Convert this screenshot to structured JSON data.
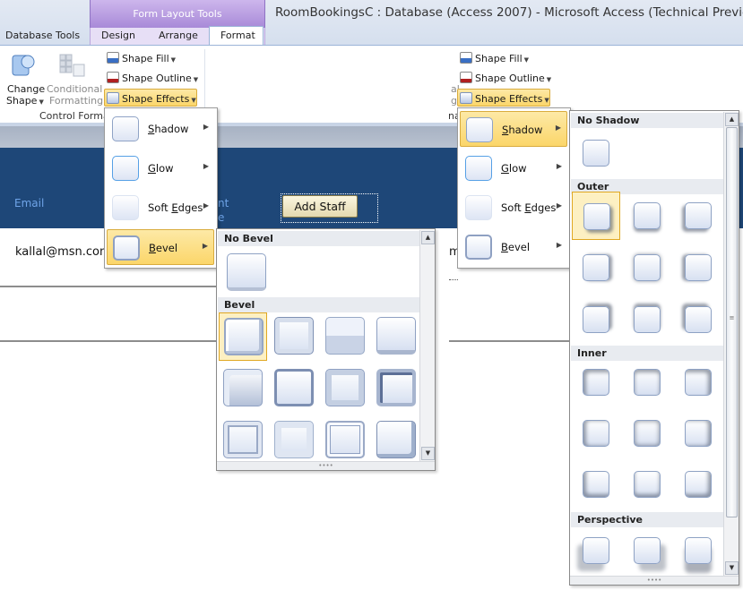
{
  "window": {
    "title": "RoomBookingsC : Database (Access 2007)  -  Microsoft Access (Technical Preview)",
    "contextual_group": "Form Layout Tools"
  },
  "tabs": [
    "Database Tools",
    "Design",
    "Arrange",
    "Format"
  ],
  "active_tab": "Format",
  "ribbon": {
    "change_shape_line1": "Change",
    "change_shape_line2": "Shape",
    "conditional_line1": "Conditional",
    "conditional_line2": "Formatting",
    "group_label": "Control Forma",
    "shape_fill": "Shape Fill",
    "shape_outline": "Shape Outline",
    "shape_effects": "Shape Effects",
    "right_group_fragment_a": "al",
    "right_group_fragment_b": "g",
    "right_group_fragment_c": "na"
  },
  "form": {
    "email_label": "Email",
    "partial_label_a": "nt",
    "partial_label_b": "e",
    "add_staff_button": "Add Staff",
    "email_value": "kallal@msn.com",
    "partial_value": "m"
  },
  "effects_menu": [
    {
      "label": "Shadow",
      "accel": "S",
      "rest": "hadow"
    },
    {
      "label": "Glow",
      "accel": "G",
      "rest": "low"
    },
    {
      "label": "Soft Edges",
      "pre": "Soft ",
      "accel": "E",
      "rest": "dges"
    },
    {
      "label": "Bevel",
      "accel": "B",
      "rest": "evel"
    }
  ],
  "bevel_gallery": {
    "no_bevel_heading": "No Bevel",
    "bevel_heading": "Bevel"
  },
  "shadow_gallery": {
    "no_shadow_heading": "No Shadow",
    "outer_heading": "Outer",
    "inner_heading": "Inner",
    "perspective_heading": "Perspective"
  },
  "colors": {
    "header_band": "#1e4778",
    "contextual_tab": "#a88ad8",
    "highlight": "#fbd66a"
  }
}
